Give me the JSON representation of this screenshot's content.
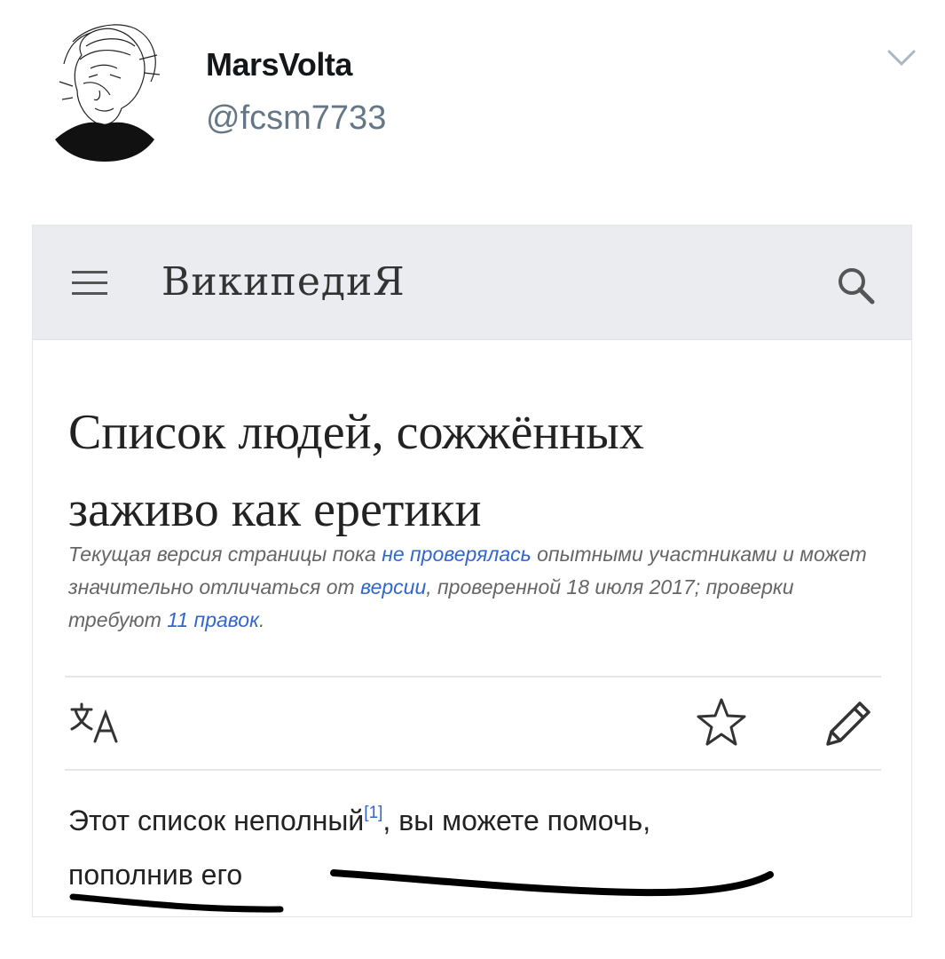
{
  "tweet": {
    "display_name": "MarsVolta",
    "handle": "@fcsm7733",
    "menu_icon": "chevron-down-icon",
    "avatar": "sketch-portrait-avatar"
  },
  "wiki": {
    "logo": "ВикипедиЯ",
    "menu_icon": "hamburger-menu-icon",
    "search_icon": "search-icon",
    "title_line1": "Список людей, сожжённых",
    "title_line2": "заживо как еретики",
    "notice": {
      "part1": "Текущая версия страницы пока ",
      "link1": "не проверялась",
      "part2": " опытными участниками и может значительно отличаться от ",
      "link2": "версии",
      "part3": ", проверенной 18 июля 2017; проверки требуют ",
      "link3": "11 правок",
      "part4": "."
    },
    "toolbar": {
      "language_icon": "translate-icon",
      "watch_icon": "star-icon",
      "edit_icon": "pencil-icon"
    },
    "intro": {
      "part1": "Этот список неполный",
      "ref": "[1]",
      "part2": ", вы можете помочь,",
      "link": "пополнив его"
    }
  },
  "colors": {
    "link": "#3366cc",
    "header_bg": "#eaecf0",
    "handle": "#657786",
    "scribble": "#000000"
  }
}
